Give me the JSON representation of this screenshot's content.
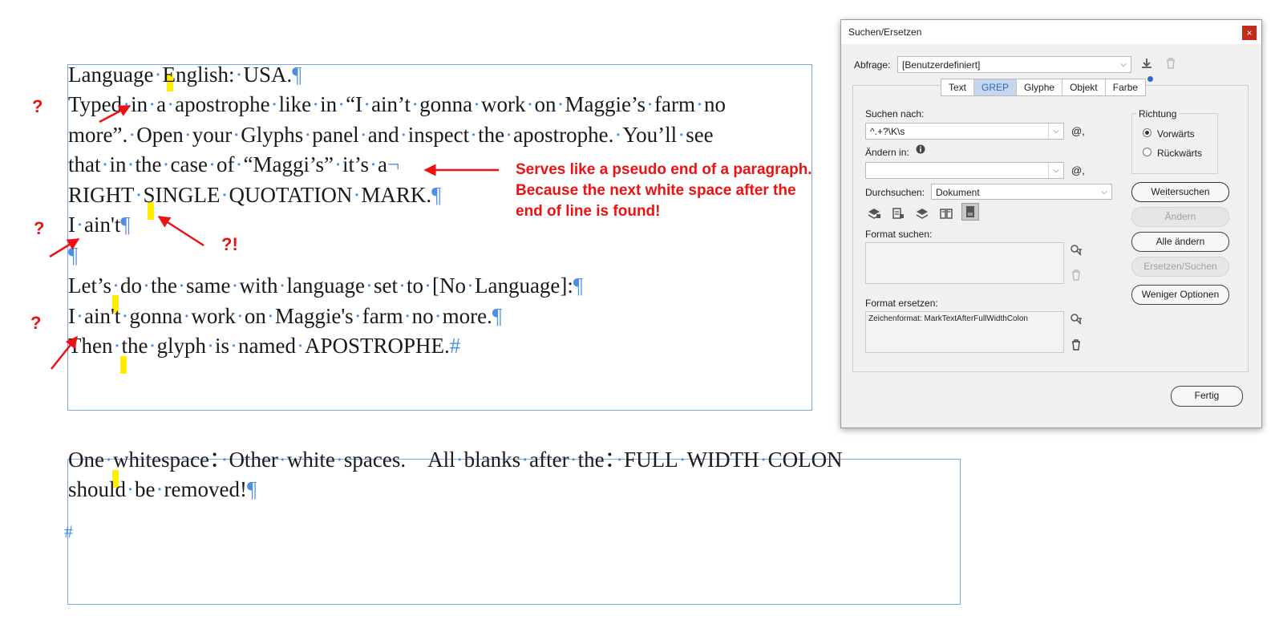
{
  "document": {
    "lines": [
      {
        "text": "Language English: USA.",
        "mark": "¶"
      },
      {
        "text": "Typed in a apostrophe like in “I ain’t gonna work on Maggie’s farm no",
        "mark": ""
      },
      {
        "text": "more”. Open your Glyphs panel and inspect the apostrophe. You’ll see",
        "mark": ""
      },
      {
        "text": "that in the case of “Maggi’s” it’s a",
        "mark": "¬"
      },
      {
        "text": "RIGHT SINGLE QUOTATION MARK.",
        "mark": "¶"
      },
      {
        "text": "I ain't",
        "mark": "¶"
      },
      {
        "text": "",
        "mark": "¶"
      },
      {
        "text": "Let’s do the same with language set to [No Language]:",
        "mark": "¶"
      },
      {
        "text": "I ain't gonna work on Maggie's farm no more.",
        "mark": "¶"
      },
      {
        "text": "Then the glyph is named APOSTROPHE.",
        "mark": "#"
      }
    ],
    "frame2_lines": [
      {
        "text": "One whitespace： Other white spaces.　All blanks after the： FULL WIDTH COLON",
        "mark": ""
      },
      {
        "text": "should be removed!",
        "mark": "¶"
      }
    ],
    "frame2_end": "#"
  },
  "annotations": {
    "q1": "?",
    "q2": "?",
    "q3": "?",
    "exclaim": "?!",
    "note_lines": [
      "Serves like a pseudo end of a paragraph.",
      "Because the next white space after the",
      "end of line is found!"
    ],
    "color": "#ee1111"
  },
  "dialog": {
    "title": "Suchen/Ersetzen",
    "close_glyph": "×",
    "query_label": "Abfrage:",
    "query_value": "[Benutzerdefiniert]",
    "tabs": [
      {
        "label": "Text",
        "active": false
      },
      {
        "label": "GREP",
        "active": true
      },
      {
        "label": "Glyphe",
        "active": false
      },
      {
        "label": "Objekt",
        "active": false
      },
      {
        "label": "Farbe",
        "active": false
      }
    ],
    "search_label": "Suchen nach:",
    "search_value": "^.+?\\K\\s",
    "replace_label": "Ändern in:",
    "replace_value": "",
    "special_char_glyph": "@,",
    "scope_label": "Durchsuchen:",
    "scope_value": "Dokument",
    "direction_label": "Richtung",
    "direction_options": [
      {
        "label": "Vorwärts",
        "selected": true
      },
      {
        "label": "Rückwärts",
        "selected": false
      }
    ],
    "find_format_label": "Format suchen:",
    "change_format_label": "Format ersetzen:",
    "change_format_value": "Zeichenformat: MarkTextAfterFullWidthColon",
    "buttons": {
      "find_next": "Weitersuchen",
      "change": "Ändern",
      "change_all": "Alle ändern",
      "change_find": "Ersetzen/Suchen",
      "fewer_options": "Weniger Optionen",
      "done": "Fertig"
    },
    "accent_color": "#2d6bc4"
  }
}
